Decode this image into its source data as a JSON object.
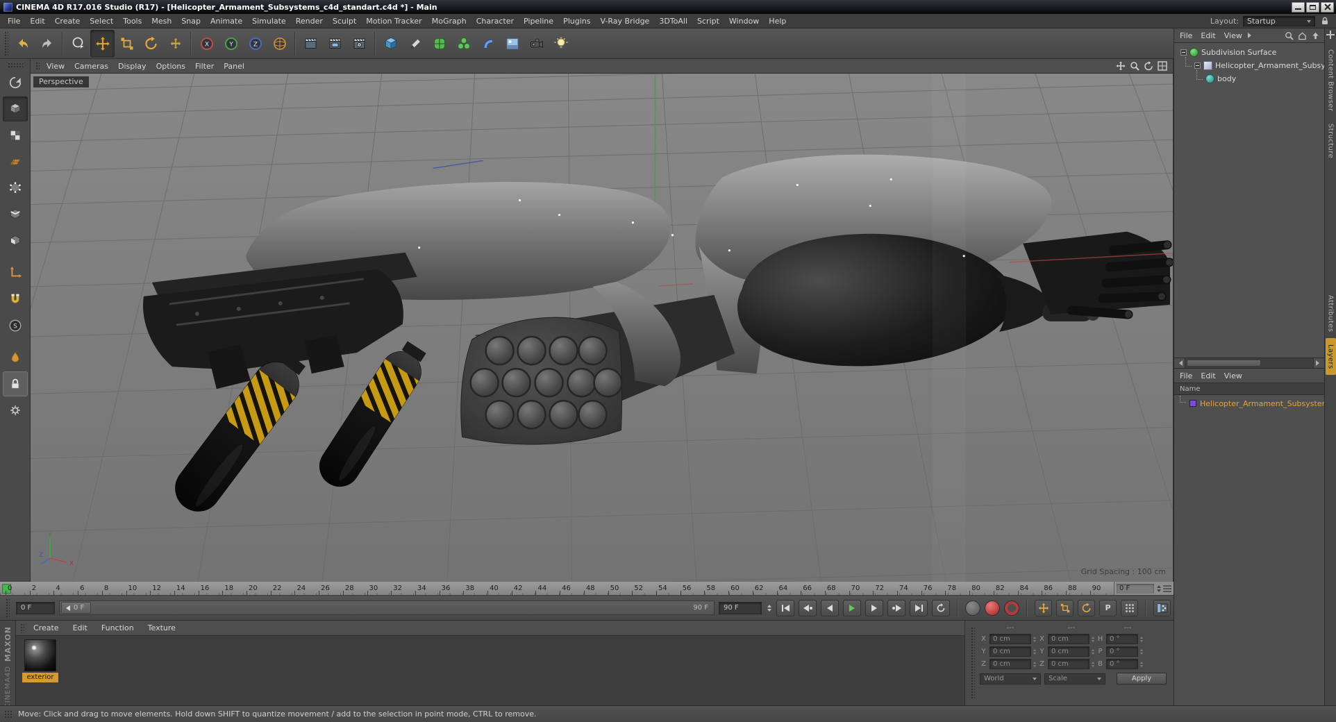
{
  "title_bar": {
    "title": "CINEMA 4D R17.016 Studio (R17) - [Helicopter_Armament_Subsystems_c4d_standart.c4d *] - Main"
  },
  "menu_bar": {
    "items": [
      "File",
      "Edit",
      "Create",
      "Select",
      "Tools",
      "Mesh",
      "Snap",
      "Animate",
      "Simulate",
      "Render",
      "Sculpt",
      "Motion Tracker",
      "MoGraph",
      "Character",
      "Pipeline",
      "Plugins",
      "V-Ray Bridge",
      "3DToAll",
      "Script",
      "Window",
      "Help"
    ],
    "layout_label": "Layout:",
    "layout_value": "Startup"
  },
  "toolbar": {
    "axis_x": "X",
    "axis_y": "Y",
    "axis_z": "Z"
  },
  "left_palette": {
    "solo_letter": "S"
  },
  "viewport": {
    "menu": [
      "View",
      "Cameras",
      "Display",
      "Options",
      "Filter",
      "Panel"
    ],
    "camera_label": "Perspective",
    "grid_spacing_label": "Grid Spacing : 100 cm",
    "axis": {
      "x": "X",
      "y": "Y",
      "z": "Z"
    }
  },
  "timeline": {
    "frames": [
      0,
      2,
      4,
      6,
      8,
      10,
      12,
      14,
      16,
      18,
      20,
      22,
      24,
      26,
      28,
      30,
      32,
      34,
      36,
      38,
      40,
      42,
      44,
      46,
      48,
      50,
      52,
      54,
      56,
      58,
      60,
      62,
      64,
      66,
      68,
      70,
      72,
      74,
      76,
      78,
      80,
      82,
      84,
      86,
      88,
      90
    ],
    "current_frame_field": "0 F"
  },
  "transport": {
    "current_frame": "0 F",
    "slider_start": "0 F",
    "slider_end": "90 F",
    "end_frame": "90 F",
    "p_toggle": "P"
  },
  "materials_panel": {
    "menu": [
      "Create",
      "Edit",
      "Function",
      "Texture"
    ],
    "materials": [
      {
        "name": "exterior"
      }
    ]
  },
  "coordinates_panel": {
    "headers": [
      "---",
      "---",
      "---"
    ],
    "rows": [
      {
        "pos_label": "X",
        "pos_value": "0 cm",
        "size_label": "X",
        "size_value": "0 cm",
        "rot_label": "H",
        "rot_value": "0 °"
      },
      {
        "pos_label": "Y",
        "pos_value": "0 cm",
        "size_label": "Y",
        "size_value": "0 cm",
        "rot_label": "P",
        "rot_value": "0 °"
      },
      {
        "pos_label": "Z",
        "pos_value": "0 cm",
        "size_label": "Z",
        "size_value": "0 cm",
        "rot_label": "B",
        "rot_value": "0 °"
      }
    ],
    "space_mode": "World",
    "size_mode": "Scale",
    "apply_label": "Apply"
  },
  "object_manager": {
    "menu": [
      "File",
      "Edit",
      "View"
    ],
    "tree": [
      {
        "label": "Subdivision Surface"
      },
      {
        "label": "Helicopter_Armament_Subsystems"
      },
      {
        "label": "body"
      }
    ]
  },
  "layer_manager": {
    "menu": [
      "File",
      "Edit",
      "View"
    ],
    "name_header": "Name",
    "layers": [
      {
        "label": "Helicopter_Armament_Subsystems"
      }
    ]
  },
  "side_tabs": {
    "top": [
      "Content Browser",
      "Structure"
    ],
    "bottom": [
      "Attributes",
      "Layers"
    ]
  },
  "status_bar": {
    "text": "Move: Click and drag to move elements. Hold down SHIFT to quantize movement / add to the selection in point mode, CTRL to remove."
  },
  "branding": {
    "maxon": "MAXON",
    "cinema": "CINEMA4D"
  },
  "colors": {
    "accent_orange": "#e2a93c",
    "selection_green": "#49b44d",
    "layer_orange": "#e3a43c",
    "material_label_bg": "#d79a2e",
    "viewport_grey": "#7c7c7c"
  }
}
